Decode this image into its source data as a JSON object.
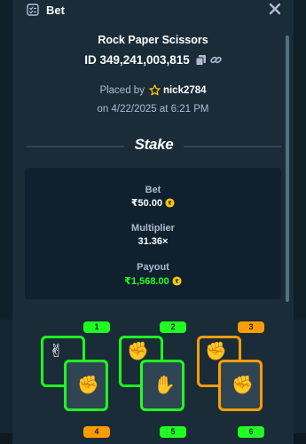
{
  "header": {
    "title": "Bet",
    "bet_icon": "receipt-icon",
    "close_icon": "close-icon"
  },
  "game": {
    "title": "Rock Paper Scissors",
    "bet_id": "ID 349,241,003,815"
  },
  "placed": {
    "label": "Placed by",
    "username": "nick2784",
    "date": "on 4/22/2025 at 6:21 PM"
  },
  "brand": {
    "logo_text": "Stake"
  },
  "details": {
    "bet_label": "Bet",
    "bet_value": "₹50.00",
    "multiplier_label": "Multiplier",
    "multiplier_value": "31.36×",
    "payout_label": "Payout",
    "payout_value": "₹1,568.00"
  },
  "colors": {
    "win": "#1fff20",
    "draw": "#ff9d00",
    "accent_coin": "#ffc800"
  },
  "rounds": [
    {
      "number": "1",
      "result": "win",
      "player": "scissors",
      "opponent": "rock"
    },
    {
      "number": "2",
      "result": "win",
      "player": "rock",
      "opponent": "paper"
    },
    {
      "number": "3",
      "result": "draw",
      "player": "rock",
      "opponent": "rock"
    },
    {
      "number": "4",
      "result": "draw"
    },
    {
      "number": "5",
      "result": "win"
    },
    {
      "number": "6",
      "result": "win"
    }
  ]
}
